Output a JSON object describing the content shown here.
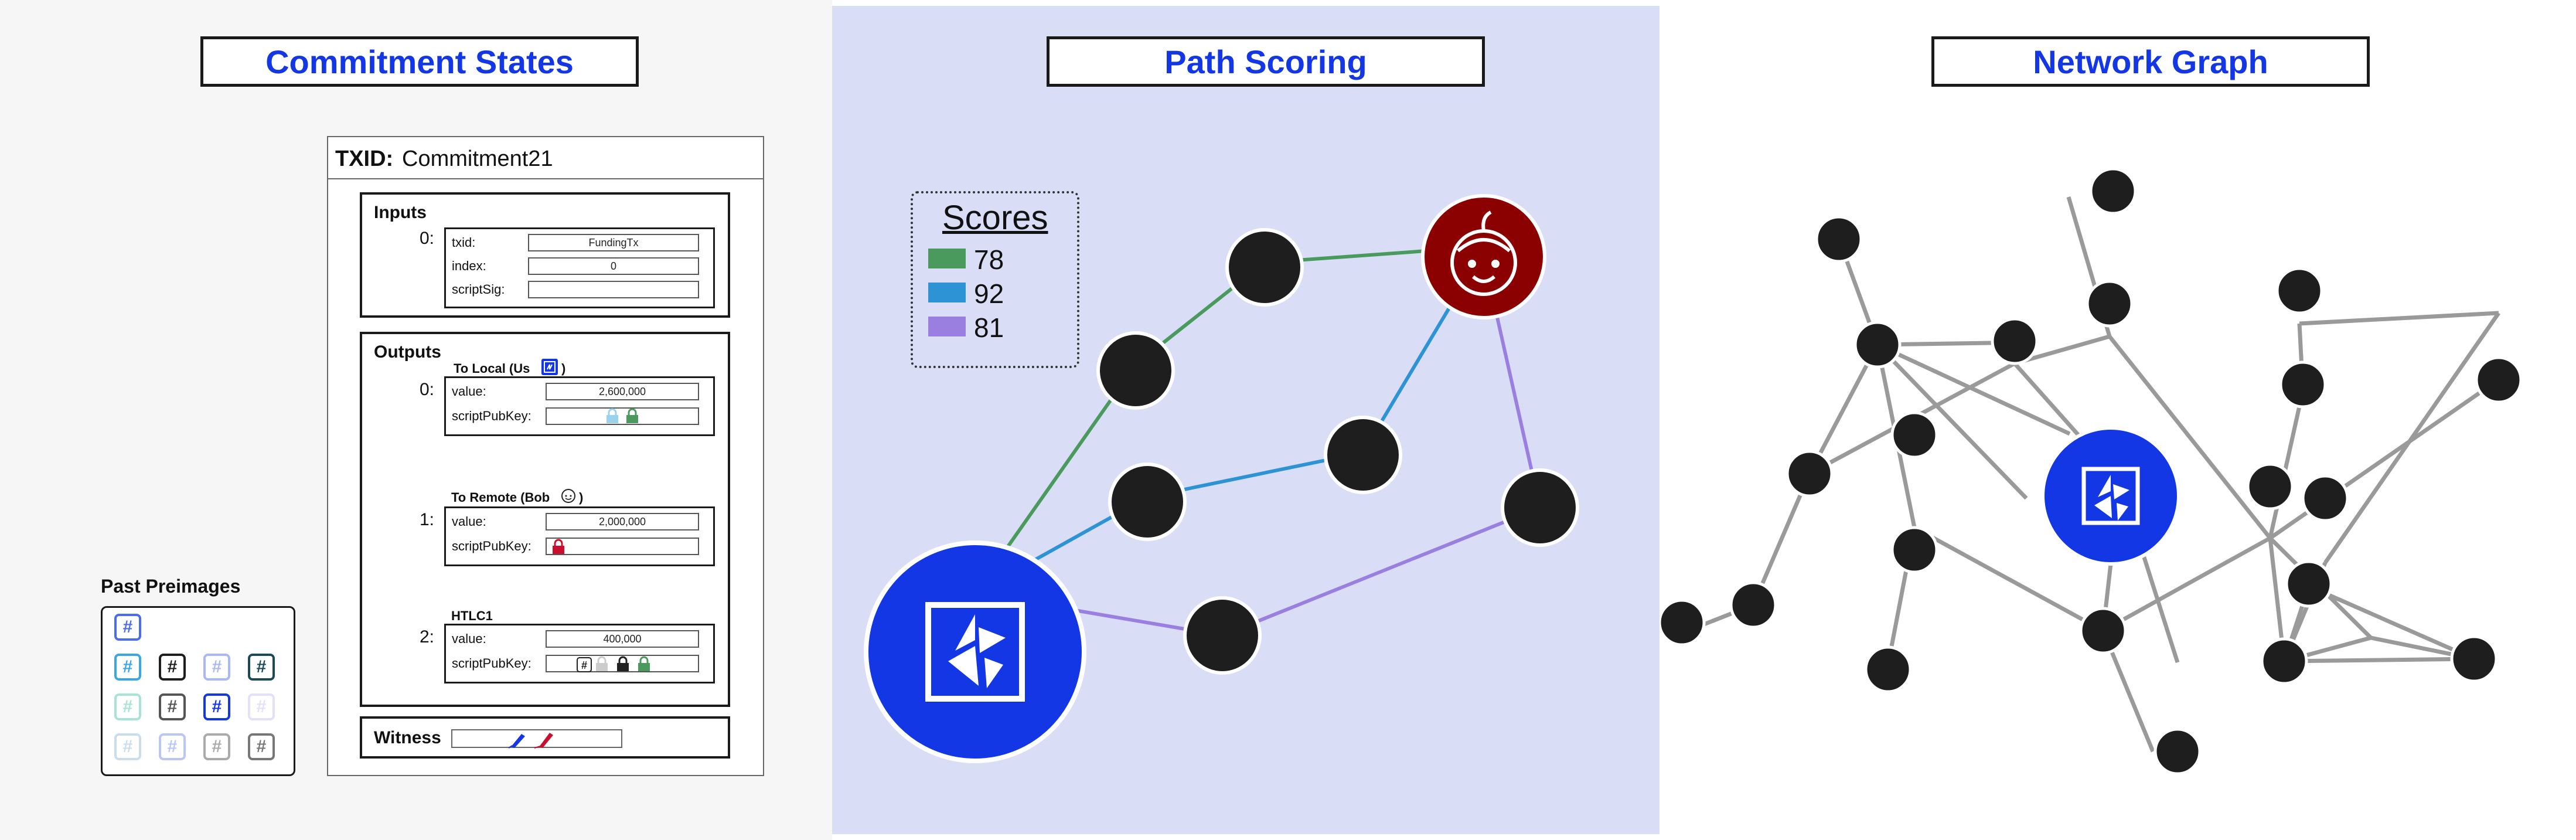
{
  "colors": {
    "accent_blue": "#1437e6",
    "bob_red": "#8b0000",
    "node_dark": "#1e1e1e",
    "path_green": "#4a9a5e",
    "path_blue": "#2e93d4",
    "path_purple": "#9b7fe0",
    "edge_gray": "#9a9a9a",
    "panel2_bg": "#d9ddf6"
  },
  "panels": {
    "commitment": {
      "title": "Commitment States"
    },
    "scoring": {
      "title": "Path Scoring"
    },
    "network": {
      "title": "Network Graph"
    }
  },
  "transaction": {
    "txid_label": "TXID:",
    "txid_value": "Commitment21",
    "inputs": {
      "heading": "Inputs",
      "index_label": "0:",
      "fields": [
        {
          "label": "txid:",
          "value": "FundingTx"
        },
        {
          "label": "index:",
          "value": "0"
        },
        {
          "label": "scriptSig:",
          "value": ""
        }
      ]
    },
    "outputs": {
      "heading": "Outputs",
      "items": [
        {
          "index": "0:",
          "title": "To Local (Us",
          "title_close": ")",
          "icon": "logo-icon",
          "value_label": "value:",
          "value": "2,600,000",
          "script_label": "scriptPubKey:",
          "script_icons": [
            "lock-light-blue-icon",
            "lock-green-icon"
          ]
        },
        {
          "index": "1:",
          "title": "To Remote (Bob",
          "title_close": ")",
          "icon": "bob-face-icon",
          "value_label": "value:",
          "value": "2,000,000",
          "script_label": "scriptPubKey:",
          "script_icons": [
            "lock-red-icon"
          ]
        },
        {
          "index": "2:",
          "title": "HTLC1",
          "title_close": "",
          "icon": "",
          "value_label": "value:",
          "value": "400,000",
          "script_label": "scriptPubKey:",
          "script_icons": [
            "hash-icon",
            "lock-gray-icon",
            "lock-black-icon",
            "lock-green-icon"
          ]
        }
      ]
    },
    "witness": {
      "label": "Witness",
      "icons": [
        "pen-blue-icon",
        "pen-red-icon"
      ]
    }
  },
  "preimages": {
    "title": "Past Preimages",
    "glyph": "#",
    "grid": [
      [
        "#4a6cf0",
        null,
        null,
        null
      ],
      [
        "#3aa6e8",
        "#1e1e1e",
        "#a9b8f6",
        "#1a4a5a"
      ],
      [
        "#a8e3d8",
        "#555555",
        "#1437e6",
        "#e4dffb"
      ],
      [
        "#c9ddee",
        "#b9c6f6",
        "#aaaaaa",
        "#777777"
      ]
    ]
  },
  "scores": {
    "title": "Scores",
    "items": [
      {
        "label": "78",
        "color": "#4a9a5e"
      },
      {
        "label": "92",
        "color": "#2e93d4"
      },
      {
        "label": "81",
        "color": "#9b7fe0"
      }
    ]
  }
}
